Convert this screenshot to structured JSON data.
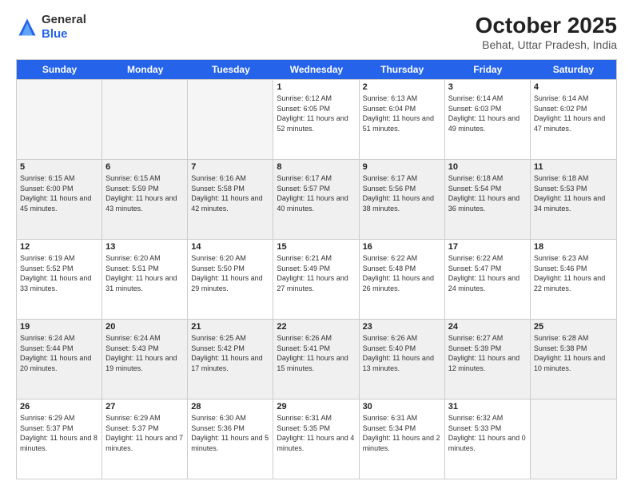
{
  "header": {
    "logo_general": "General",
    "logo_blue": "Blue",
    "month_title": "October 2025",
    "location": "Behat, Uttar Pradesh, India"
  },
  "weekdays": [
    "Sunday",
    "Monday",
    "Tuesday",
    "Wednesday",
    "Thursday",
    "Friday",
    "Saturday"
  ],
  "rows": [
    [
      {
        "day": "",
        "empty": true
      },
      {
        "day": "",
        "empty": true
      },
      {
        "day": "",
        "empty": true
      },
      {
        "day": "1",
        "rise": "6:12 AM",
        "set": "6:05 PM",
        "daylight": "11 hours and 52 minutes."
      },
      {
        "day": "2",
        "rise": "6:13 AM",
        "set": "6:04 PM",
        "daylight": "11 hours and 51 minutes."
      },
      {
        "day": "3",
        "rise": "6:14 AM",
        "set": "6:03 PM",
        "daylight": "11 hours and 49 minutes."
      },
      {
        "day": "4",
        "rise": "6:14 AM",
        "set": "6:02 PM",
        "daylight": "11 hours and 47 minutes."
      }
    ],
    [
      {
        "day": "5",
        "rise": "6:15 AM",
        "set": "6:00 PM",
        "daylight": "11 hours and 45 minutes."
      },
      {
        "day": "6",
        "rise": "6:15 AM",
        "set": "5:59 PM",
        "daylight": "11 hours and 43 minutes."
      },
      {
        "day": "7",
        "rise": "6:16 AM",
        "set": "5:58 PM",
        "daylight": "11 hours and 42 minutes."
      },
      {
        "day": "8",
        "rise": "6:17 AM",
        "set": "5:57 PM",
        "daylight": "11 hours and 40 minutes."
      },
      {
        "day": "9",
        "rise": "6:17 AM",
        "set": "5:56 PM",
        "daylight": "11 hours and 38 minutes."
      },
      {
        "day": "10",
        "rise": "6:18 AM",
        "set": "5:54 PM",
        "daylight": "11 hours and 36 minutes."
      },
      {
        "day": "11",
        "rise": "6:18 AM",
        "set": "5:53 PM",
        "daylight": "11 hours and 34 minutes."
      }
    ],
    [
      {
        "day": "12",
        "rise": "6:19 AM",
        "set": "5:52 PM",
        "daylight": "11 hours and 33 minutes."
      },
      {
        "day": "13",
        "rise": "6:20 AM",
        "set": "5:51 PM",
        "daylight": "11 hours and 31 minutes."
      },
      {
        "day": "14",
        "rise": "6:20 AM",
        "set": "5:50 PM",
        "daylight": "11 hours and 29 minutes."
      },
      {
        "day": "15",
        "rise": "6:21 AM",
        "set": "5:49 PM",
        "daylight": "11 hours and 27 minutes."
      },
      {
        "day": "16",
        "rise": "6:22 AM",
        "set": "5:48 PM",
        "daylight": "11 hours and 26 minutes."
      },
      {
        "day": "17",
        "rise": "6:22 AM",
        "set": "5:47 PM",
        "daylight": "11 hours and 24 minutes."
      },
      {
        "day": "18",
        "rise": "6:23 AM",
        "set": "5:46 PM",
        "daylight": "11 hours and 22 minutes."
      }
    ],
    [
      {
        "day": "19",
        "rise": "6:24 AM",
        "set": "5:44 PM",
        "daylight": "11 hours and 20 minutes."
      },
      {
        "day": "20",
        "rise": "6:24 AM",
        "set": "5:43 PM",
        "daylight": "11 hours and 19 minutes."
      },
      {
        "day": "21",
        "rise": "6:25 AM",
        "set": "5:42 PM",
        "daylight": "11 hours and 17 minutes."
      },
      {
        "day": "22",
        "rise": "6:26 AM",
        "set": "5:41 PM",
        "daylight": "11 hours and 15 minutes."
      },
      {
        "day": "23",
        "rise": "6:26 AM",
        "set": "5:40 PM",
        "daylight": "11 hours and 13 minutes."
      },
      {
        "day": "24",
        "rise": "6:27 AM",
        "set": "5:39 PM",
        "daylight": "11 hours and 12 minutes."
      },
      {
        "day": "25",
        "rise": "6:28 AM",
        "set": "5:38 PM",
        "daylight": "11 hours and 10 minutes."
      }
    ],
    [
      {
        "day": "26",
        "rise": "6:29 AM",
        "set": "5:37 PM",
        "daylight": "11 hours and 8 minutes."
      },
      {
        "day": "27",
        "rise": "6:29 AM",
        "set": "5:37 PM",
        "daylight": "11 hours and 7 minutes."
      },
      {
        "day": "28",
        "rise": "6:30 AM",
        "set": "5:36 PM",
        "daylight": "11 hours and 5 minutes."
      },
      {
        "day": "29",
        "rise": "6:31 AM",
        "set": "5:35 PM",
        "daylight": "11 hours and 4 minutes."
      },
      {
        "day": "30",
        "rise": "6:31 AM",
        "set": "5:34 PM",
        "daylight": "11 hours and 2 minutes."
      },
      {
        "day": "31",
        "rise": "6:32 AM",
        "set": "5:33 PM",
        "daylight": "11 hours and 0 minutes."
      },
      {
        "day": "",
        "empty": true
      }
    ]
  ],
  "labels": {
    "sunrise": "Sunrise:",
    "sunset": "Sunset:",
    "daylight": "Daylight:"
  }
}
